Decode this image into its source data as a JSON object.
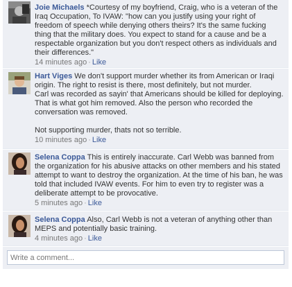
{
  "comments": [
    {
      "author": "Joie Michaels",
      "text": "*Courtesy of my boyfriend, Craig, who is a veteran of the Iraq Occupation, To IVAW: \"how can you justify using your right of freedom of speech while denying others theirs? It's the same fucking thing that the military does. You expect to stand for a cause and be a respectable organization but you don't respect others as individuals and their differences.\"",
      "time": "14 minutes ago",
      "like": "Like"
    },
    {
      "author": "Hart Viges",
      "text": "We don't support murder whether its from American or Iraqi origin. The right to resist is there, most definitely, but not murder.\nCarl was recorded as sayin' that Americans should be killed for deploying. That is what got him removed. Also the person who recorded the conversation was removed.\n\nNot supporting murder, thats not so terrible.",
      "time": "10 minutes ago",
      "like": "Like"
    },
    {
      "author": "Selena Coppa",
      "text": "This is entirely inaccurate. Carl Webb was banned from the organization for his abusive attacks on other members and his stated attempt to want to destroy the organization. At the time of his ban, he was told that included IVAW events. For him to even try to register was a deliberate attempt to be provocative.",
      "time": "5 minutes ago",
      "like": "Like"
    },
    {
      "author": "Selena Coppa",
      "text": "Also, Carl Webb is not a veteran of anything other than MEPS and potentially basic training.",
      "time": "4 minutes ago",
      "like": "Like"
    }
  ],
  "compose": {
    "placeholder": "Write a comment..."
  },
  "colors": {
    "link": "#3b5998",
    "background": "#edeff4",
    "meta": "#777777"
  }
}
